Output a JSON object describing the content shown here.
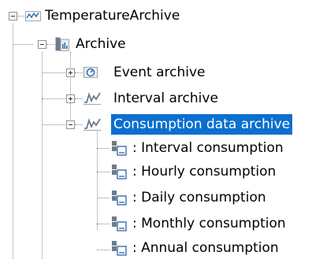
{
  "tree": {
    "root": {
      "label": "TemperatureArchive",
      "icon": "trend-line-icon",
      "expanded": true
    },
    "archive": {
      "label": "Archive",
      "icon": "archive-folder-icon",
      "expanded": true
    },
    "children": [
      {
        "label": "Event archive",
        "icon": "event-archive-icon",
        "expanded": false
      },
      {
        "label": "Interval archive",
        "icon": "trend-line-icon",
        "expanded": false
      },
      {
        "label": "Consumption data archive",
        "icon": "trend-line-icon",
        "expanded": true,
        "selected": true
      }
    ],
    "consumption_items": [
      {
        "label": ": Interval consumption",
        "icon": "consumption-table-icon"
      },
      {
        "label": ": Hourly consumption",
        "icon": "consumption-table-icon"
      },
      {
        "label": ": Daily consumption",
        "icon": "consumption-table-icon"
      },
      {
        "label": ": Monthly consumption",
        "icon": "consumption-table-icon"
      },
      {
        "label": ": Annual consumption",
        "icon": "consumption-table-icon"
      }
    ]
  },
  "colors": {
    "selection": "#0b6fd0",
    "selection_text": "#ffffff",
    "tree_line": "#8a8a8a",
    "icon_blue": "#3b6fb0",
    "icon_gray": "#6d7b8a"
  }
}
